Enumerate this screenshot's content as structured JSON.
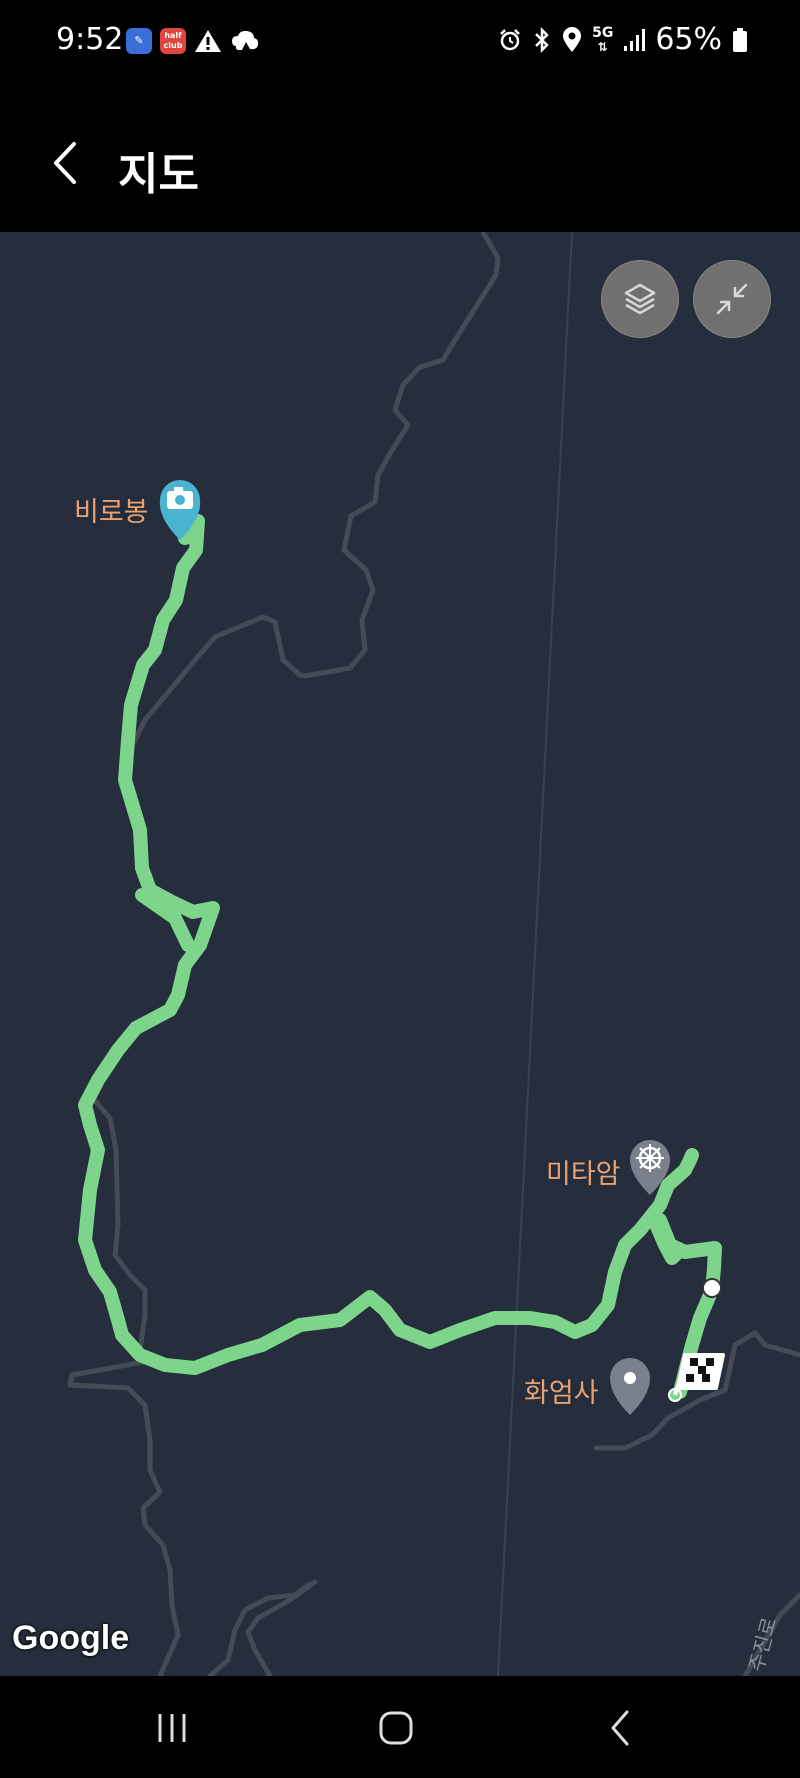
{
  "status_bar": {
    "time": "9:52",
    "battery": "65%",
    "left_icons": [
      "app-badge-blue",
      "halfclub-badge",
      "warning-icon",
      "weather-icon"
    ],
    "halfclub_label": "half club",
    "right_icons": [
      "alarm-icon",
      "bluetooth-icon",
      "location-icon",
      "5g-icon",
      "signal-icon",
      "battery-icon"
    ],
    "network_label": "5G"
  },
  "app_bar": {
    "title": "지도",
    "back_icon": "chevron-left-icon"
  },
  "map": {
    "buttons": [
      {
        "name": "layers-button",
        "icon": "layers-icon"
      },
      {
        "name": "collapse-button",
        "icon": "collapse-icon"
      }
    ],
    "pois": [
      {
        "label": "비로봉",
        "icon": "camera-pin-icon"
      },
      {
        "label": "미타암",
        "icon": "temple-pin-icon"
      },
      {
        "label": "화엄사",
        "icon": "location-pin-icon"
      }
    ],
    "road_label": "주진로",
    "attribution": "Google",
    "colors": {
      "background": "#262e3d",
      "route": "#7dd48b",
      "road": "#4a4f58",
      "poi_label": "#e8a070"
    }
  },
  "nav_bar": {
    "buttons": [
      "recent-apps-icon",
      "home-icon",
      "back-icon"
    ]
  }
}
